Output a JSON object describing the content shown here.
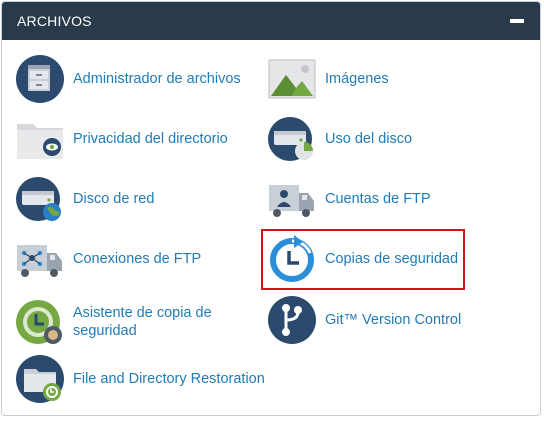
{
  "panel": {
    "title": "ARCHIVOS",
    "collapse_icon": "minus-icon"
  },
  "items": [
    {
      "label": "Administrador de archivos",
      "icon": "file-manager-icon"
    },
    {
      "label": "Imágenes",
      "icon": "images-icon"
    },
    {
      "label": "Privacidad del directorio",
      "icon": "directory-privacy-icon"
    },
    {
      "label": "Uso del disco",
      "icon": "disk-usage-icon"
    },
    {
      "label": "Disco de red",
      "icon": "web-disk-icon"
    },
    {
      "label": "Cuentas de FTP",
      "icon": "ftp-accounts-icon"
    },
    {
      "label": "Conexiones de FTP",
      "icon": "ftp-connections-icon"
    },
    {
      "label": "Copias de seguridad",
      "icon": "backup-icon"
    },
    {
      "label": "Asistente de copia de seguridad",
      "icon": "backup-wizard-icon"
    },
    {
      "label": "Git™ Version Control",
      "icon": "git-icon"
    },
    {
      "label": "File and Directory Restoration",
      "icon": "file-restoration-icon"
    }
  ],
  "colors": {
    "header_bg": "#293a4a",
    "link": "#1f7cb8",
    "highlight_border": "#d3121a",
    "icon_navy": "#2c4a6e",
    "icon_green": "#75a843",
    "icon_blue": "#2a8fd8"
  }
}
